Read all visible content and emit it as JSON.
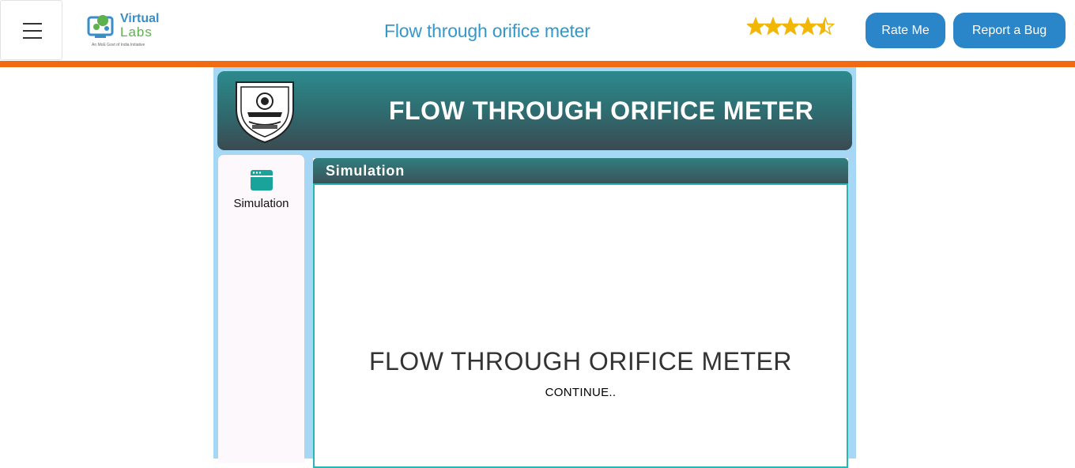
{
  "header": {
    "logo_line1": "Virtual",
    "logo_line2": "Labs",
    "logo_tagline": "An MoE Govt of India Initiative",
    "title": "Flow through orifice meter",
    "rating": 4.5,
    "rating_max": 5,
    "rate_button": "Rate Me",
    "bug_button": "Report a Bug"
  },
  "banner": {
    "title": "FLOW THROUGH ORIFICE METER"
  },
  "sidebar": {
    "items": [
      {
        "label": "Simulation",
        "icon": "window-icon"
      }
    ]
  },
  "panel": {
    "title": "Simulation",
    "sim_title": "FLOW THROUGH ORIFICE METER",
    "continue_label": "CONTINUE.."
  },
  "colors": {
    "accent_blue": "#2a86c9",
    "orange_rule": "#f06b12",
    "frame_blue": "#a6d8f5",
    "teal": "#2c8a8d"
  }
}
